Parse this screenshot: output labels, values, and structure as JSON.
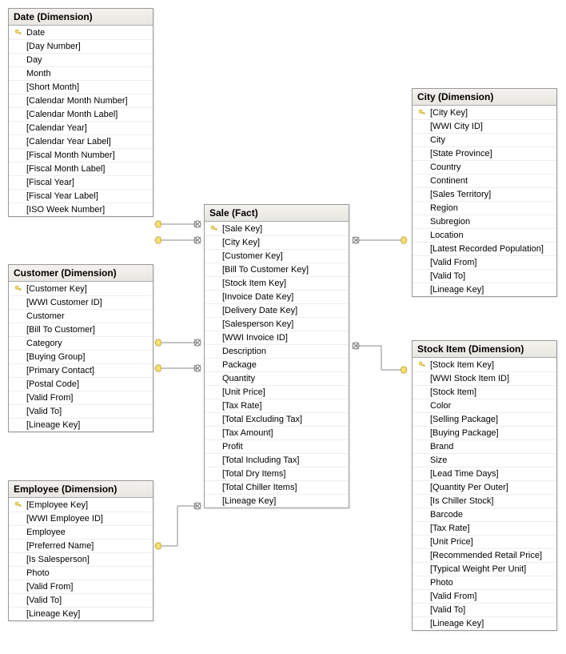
{
  "tables": {
    "date": {
      "title": "Date (Dimension)",
      "columns": [
        {
          "label": "Date",
          "pk": true
        },
        {
          "label": "[Day Number]",
          "pk": false
        },
        {
          "label": "Day",
          "pk": false
        },
        {
          "label": "Month",
          "pk": false
        },
        {
          "label": "[Short Month]",
          "pk": false
        },
        {
          "label": "[Calendar Month Number]",
          "pk": false
        },
        {
          "label": "[Calendar Month Label]",
          "pk": false
        },
        {
          "label": "[Calendar Year]",
          "pk": false
        },
        {
          "label": "[Calendar Year Label]",
          "pk": false
        },
        {
          "label": "[Fiscal Month Number]",
          "pk": false
        },
        {
          "label": "[Fiscal Month Label]",
          "pk": false
        },
        {
          "label": "[Fiscal Year]",
          "pk": false
        },
        {
          "label": "[Fiscal Year Label]",
          "pk": false
        },
        {
          "label": "[ISO Week Number]",
          "pk": false
        }
      ]
    },
    "customer": {
      "title": "Customer (Dimension)",
      "columns": [
        {
          "label": "[Customer Key]",
          "pk": true
        },
        {
          "label": "[WWI Customer ID]",
          "pk": false
        },
        {
          "label": "Customer",
          "pk": false
        },
        {
          "label": "[Bill To Customer]",
          "pk": false
        },
        {
          "label": "Category",
          "pk": false
        },
        {
          "label": "[Buying Group]",
          "pk": false
        },
        {
          "label": "[Primary Contact]",
          "pk": false
        },
        {
          "label": "[Postal Code]",
          "pk": false
        },
        {
          "label": "[Valid From]",
          "pk": false
        },
        {
          "label": "[Valid To]",
          "pk": false
        },
        {
          "label": "[Lineage Key]",
          "pk": false
        }
      ]
    },
    "employee": {
      "title": "Employee (Dimension)",
      "columns": [
        {
          "label": "[Employee Key]",
          "pk": true
        },
        {
          "label": "[WWI Employee ID]",
          "pk": false
        },
        {
          "label": "Employee",
          "pk": false
        },
        {
          "label": "[Preferred Name]",
          "pk": false
        },
        {
          "label": "[Is Salesperson]",
          "pk": false
        },
        {
          "label": "Photo",
          "pk": false
        },
        {
          "label": "[Valid From]",
          "pk": false
        },
        {
          "label": "[Valid To]",
          "pk": false
        },
        {
          "label": "[Lineage Key]",
          "pk": false
        }
      ]
    },
    "sale": {
      "title": "Sale (Fact)",
      "columns": [
        {
          "label": "[Sale Key]",
          "pk": true
        },
        {
          "label": "[City Key]",
          "pk": false
        },
        {
          "label": "[Customer Key]",
          "pk": false
        },
        {
          "label": "[Bill To Customer Key]",
          "pk": false
        },
        {
          "label": "[Stock Item Key]",
          "pk": false
        },
        {
          "label": "[Invoice Date Key]",
          "pk": false
        },
        {
          "label": "[Delivery Date Key]",
          "pk": false
        },
        {
          "label": "[Salesperson Key]",
          "pk": false
        },
        {
          "label": "[WWI Invoice ID]",
          "pk": false
        },
        {
          "label": "Description",
          "pk": false
        },
        {
          "label": "Package",
          "pk": false
        },
        {
          "label": "Quantity",
          "pk": false
        },
        {
          "label": "[Unit Price]",
          "pk": false
        },
        {
          "label": "[Tax Rate]",
          "pk": false
        },
        {
          "label": "[Total Excluding Tax]",
          "pk": false
        },
        {
          "label": "[Tax Amount]",
          "pk": false
        },
        {
          "label": "Profit",
          "pk": false
        },
        {
          "label": "[Total Including Tax]",
          "pk": false
        },
        {
          "label": "[Total Dry Items]",
          "pk": false
        },
        {
          "label": "[Total Chiller Items]",
          "pk": false
        },
        {
          "label": "[Lineage Key]",
          "pk": false
        }
      ]
    },
    "city": {
      "title": "City (Dimension)",
      "columns": [
        {
          "label": "[City Key]",
          "pk": true
        },
        {
          "label": "[WWI City ID]",
          "pk": false
        },
        {
          "label": "City",
          "pk": false
        },
        {
          "label": "[State Province]",
          "pk": false
        },
        {
          "label": "Country",
          "pk": false
        },
        {
          "label": "Continent",
          "pk": false
        },
        {
          "label": "[Sales Territory]",
          "pk": false
        },
        {
          "label": "Region",
          "pk": false
        },
        {
          "label": "Subregion",
          "pk": false
        },
        {
          "label": "Location",
          "pk": false
        },
        {
          "label": "[Latest Recorded Population]",
          "pk": false
        },
        {
          "label": "[Valid From]",
          "pk": false
        },
        {
          "label": "[Valid To]",
          "pk": false
        },
        {
          "label": "[Lineage Key]",
          "pk": false
        }
      ]
    },
    "stockitem": {
      "title": "Stock Item (Dimension)",
      "columns": [
        {
          "label": "[Stock Item Key]",
          "pk": true
        },
        {
          "label": "[WWI Stock Item ID]",
          "pk": false
        },
        {
          "label": "[Stock Item]",
          "pk": false
        },
        {
          "label": "Color",
          "pk": false
        },
        {
          "label": "[Selling Package]",
          "pk": false
        },
        {
          "label": "[Buying Package]",
          "pk": false
        },
        {
          "label": "Brand",
          "pk": false
        },
        {
          "label": "Size",
          "pk": false
        },
        {
          "label": "[Lead Time Days]",
          "pk": false
        },
        {
          "label": "[Quantity Per Outer]",
          "pk": false
        },
        {
          "label": "[Is Chiller Stock]",
          "pk": false
        },
        {
          "label": "Barcode",
          "pk": false
        },
        {
          "label": "[Tax Rate]",
          "pk": false
        },
        {
          "label": "[Unit Price]",
          "pk": false
        },
        {
          "label": "[Recommended Retail Price]",
          "pk": false
        },
        {
          "label": "[Typical Weight Per Unit]",
          "pk": false
        },
        {
          "label": "Photo",
          "pk": false
        },
        {
          "label": "[Valid From]",
          "pk": false
        },
        {
          "label": "[Valid To]",
          "pk": false
        },
        {
          "label": "[Lineage Key]",
          "pk": false
        }
      ]
    }
  },
  "relationships": [
    {
      "from": "sale",
      "to": "date",
      "count": 2
    },
    {
      "from": "sale",
      "to": "customer",
      "count": 2
    },
    {
      "from": "sale",
      "to": "employee",
      "count": 1
    },
    {
      "from": "sale",
      "to": "city",
      "count": 1
    },
    {
      "from": "sale",
      "to": "stockitem",
      "count": 1
    }
  ]
}
